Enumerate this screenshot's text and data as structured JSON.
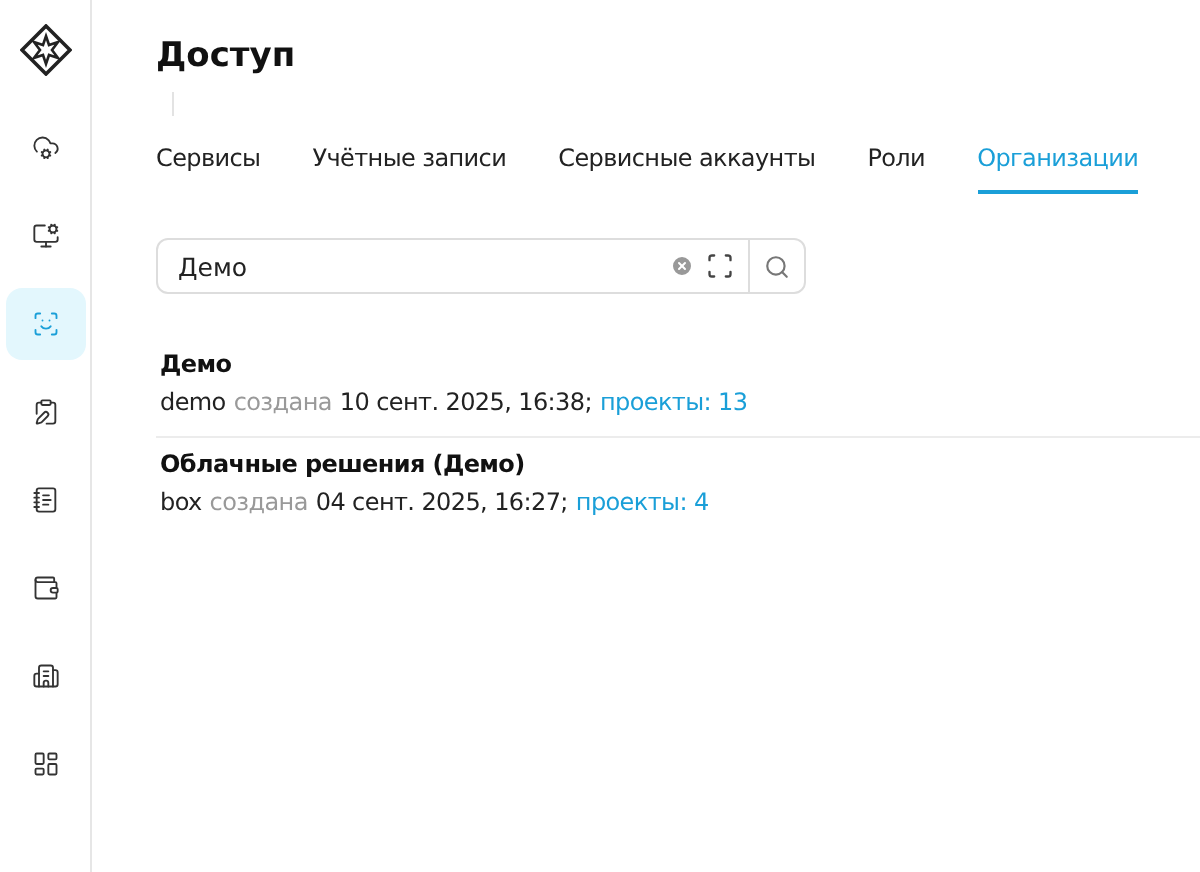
{
  "sidebar": {
    "items": [
      {
        "selected": false
      },
      {
        "selected": false
      },
      {
        "selected": true
      },
      {
        "selected": false
      },
      {
        "selected": false
      },
      {
        "selected": false
      },
      {
        "selected": false
      },
      {
        "selected": false
      }
    ]
  },
  "page": {
    "title": "Доступ"
  },
  "tabs": [
    {
      "label": "Сервисы",
      "selected": false
    },
    {
      "label": "Учётные записи",
      "selected": false
    },
    {
      "label": "Сервисные аккаунты",
      "selected": false
    },
    {
      "label": "Роли",
      "selected": false
    },
    {
      "label": "Организации",
      "selected": true
    }
  ],
  "search": {
    "value": "Демо"
  },
  "organizations": [
    {
      "name": "Демо",
      "slug": "demo",
      "created_label": "создана",
      "created": "10 сент. 2025, 16:38",
      "separator": ";",
      "projects": "проекты: 13"
    },
    {
      "name": "Облачные решения (Демо)",
      "slug": "box",
      "created_label": "создана",
      "created": "04 сент. 2025, 16:27",
      "separator": ";",
      "projects": "проекты: 4"
    }
  ]
}
